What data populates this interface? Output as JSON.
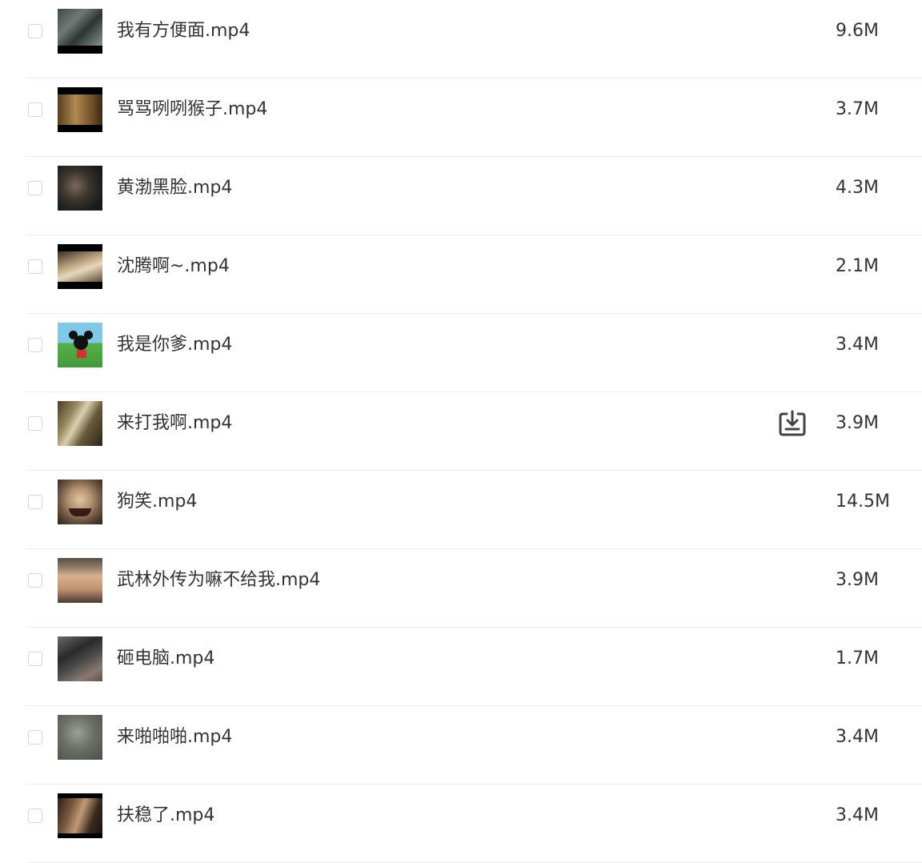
{
  "files": [
    {
      "name": "我有方便面.mp4",
      "size": "9.6M",
      "thumbnail": "people-street-thumbnail"
    },
    {
      "name": "骂骂咧咧猴子.mp4",
      "size": "3.7M",
      "thumbnail": "monkey-thumbnail"
    },
    {
      "name": "黄渤黑脸.mp4",
      "size": "4.3M",
      "thumbnail": "dark-face-thumbnail"
    },
    {
      "name": "沈腾啊~.mp4",
      "size": "2.1M",
      "thumbnail": "bright-scene-thumbnail"
    },
    {
      "name": "我是你爹.mp4",
      "size": "3.4M",
      "thumbnail": "cartoon-mouse-thumbnail"
    },
    {
      "name": "来打我啊.mp4",
      "size": "3.9M",
      "thumbnail": "crowd-scene-thumbnail",
      "download_icon": "download-icon"
    },
    {
      "name": "狗笑.mp4",
      "size": "14.5M",
      "thumbnail": "dog-face-thumbnail"
    },
    {
      "name": "武林外传为嘛不给我.mp4",
      "size": "3.9M",
      "thumbnail": "man-face-thumbnail"
    },
    {
      "name": "砸电脑.mp4",
      "size": "1.7M",
      "thumbnail": "laptop-thumbnail"
    },
    {
      "name": "来啪啪啪.mp4",
      "size": "3.4M",
      "thumbnail": "seal-thumbnail"
    },
    {
      "name": "扶稳了.mp4",
      "size": "3.4M",
      "thumbnail": "people-close-thumbnail"
    }
  ],
  "colors": {
    "text": "#333333",
    "divider": "#ededed",
    "checkbox_border": "#d6d6d6",
    "icon": "#444444"
  }
}
